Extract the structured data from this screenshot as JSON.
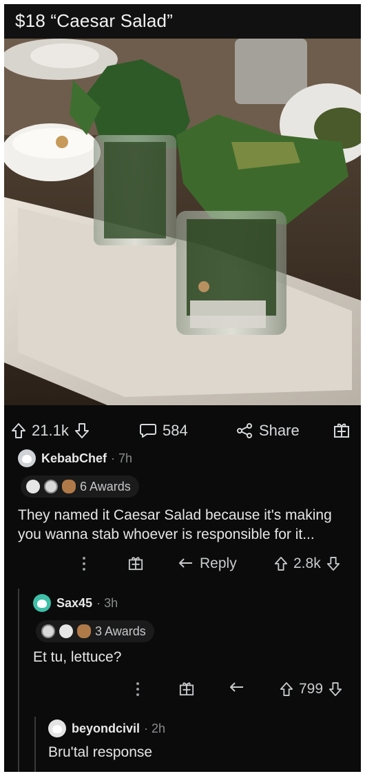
{
  "title": "$18 “Caesar Salad”",
  "post": {
    "upvotes": "21.1k",
    "comments": "584",
    "share_label": "Share"
  },
  "comments": [
    {
      "username": "KebabChef",
      "age": "7h",
      "awards": "6 Awards",
      "text": "They named it Caesar Salad because it's making you wanna stab whoever is responsible for it...",
      "reply_label": "Reply",
      "score": "2.8k"
    },
    {
      "username": "Sax45",
      "age": "3h",
      "awards": "3 Awards",
      "text": "Et tu, lettuce?",
      "score": "799"
    },
    {
      "username": "beyondcivil",
      "age": "2h",
      "text": "Bru'tal response"
    }
  ],
  "icons": [
    "upvote-icon",
    "downvote-icon",
    "comment-icon",
    "share-icon",
    "gift-icon",
    "more-icon",
    "reply-icon"
  ],
  "colors": {
    "background": "#0b0b0b",
    "text": "#d7dadc",
    "muted": "#8a8c8e"
  }
}
